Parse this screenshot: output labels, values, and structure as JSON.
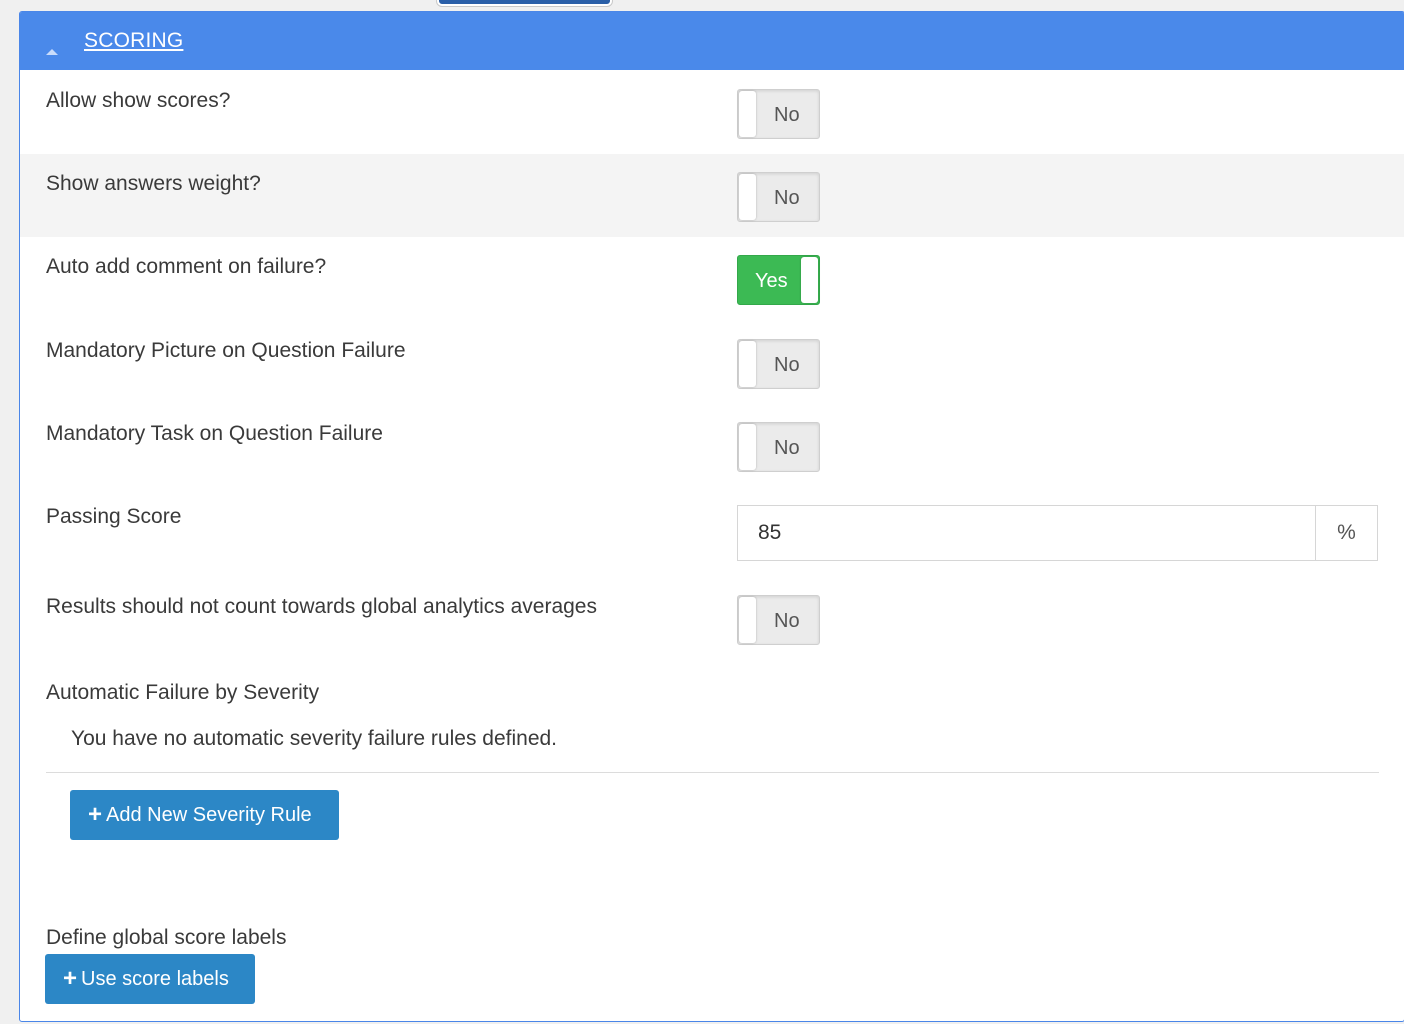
{
  "panel": {
    "title": "SCORING"
  },
  "settings": [
    {
      "label": "Allow show scores?",
      "value": "No"
    },
    {
      "label": "Show answers weight?",
      "value": "No"
    },
    {
      "label": "Auto add comment on failure?",
      "value": "Yes"
    },
    {
      "label": "Mandatory Picture on Question Failure",
      "value": "No"
    },
    {
      "label": "Mandatory Task on Question Failure",
      "value": "No"
    }
  ],
  "passing_score": {
    "label": "Passing Score",
    "value": "85",
    "unit": "%"
  },
  "global_analytics": {
    "label": "Results should not count towards global analytics averages",
    "value": "No"
  },
  "severity": {
    "heading": "Automatic Failure by Severity",
    "empty_message": "You have no automatic severity failure rules defined.",
    "add_button_label": "Add New Severity Rule"
  },
  "score_labels": {
    "heading": "Define global score labels",
    "button_label": "Use score labels"
  },
  "icons": {
    "collapse": "caret-up-icon",
    "add": "plus-icon"
  },
  "colors": {
    "header": "#4a89ea",
    "toggle_on": "#3cba54",
    "button": "#2c87c6"
  }
}
